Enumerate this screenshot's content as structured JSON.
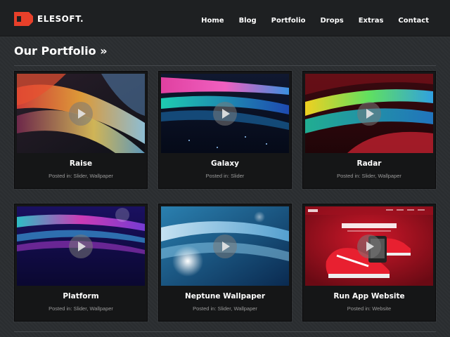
{
  "header": {
    "logo_text": "ELESOFT.",
    "logo_icon": "elesoft-logo-icon",
    "nav": [
      {
        "label": "Home"
      },
      {
        "label": "Blog"
      },
      {
        "label": "Portfolio"
      },
      {
        "label": "Drops"
      },
      {
        "label": "Extras"
      },
      {
        "label": "Contact"
      }
    ]
  },
  "main": {
    "title": "Our Portfolio »",
    "posted_prefix": "Posted in:",
    "items": [
      {
        "title": "Raise",
        "categories": "Slider, Wallpaper",
        "thumb_icon": "play-icon"
      },
      {
        "title": "Galaxy",
        "categories": "Slider",
        "thumb_icon": "play-icon"
      },
      {
        "title": "Radar",
        "categories": "Slider, Wallpaper",
        "thumb_icon": "play-icon"
      },
      {
        "title": "Platform",
        "categories": "Slider, Wallpaper",
        "thumb_icon": "play-icon"
      },
      {
        "title": "Neptune Wallpaper",
        "categories": "Slider, Wallpaper",
        "thumb_icon": "play-icon"
      },
      {
        "title": "Run App Website",
        "categories": "Website",
        "thumb_icon": "play-icon"
      }
    ]
  },
  "colors": {
    "header_bg": "#1e2022",
    "page_bg": "#2b2e31",
    "card_bg": "#151617",
    "logo_red": "#e8402a",
    "meta_text": "#9a9a9a"
  }
}
